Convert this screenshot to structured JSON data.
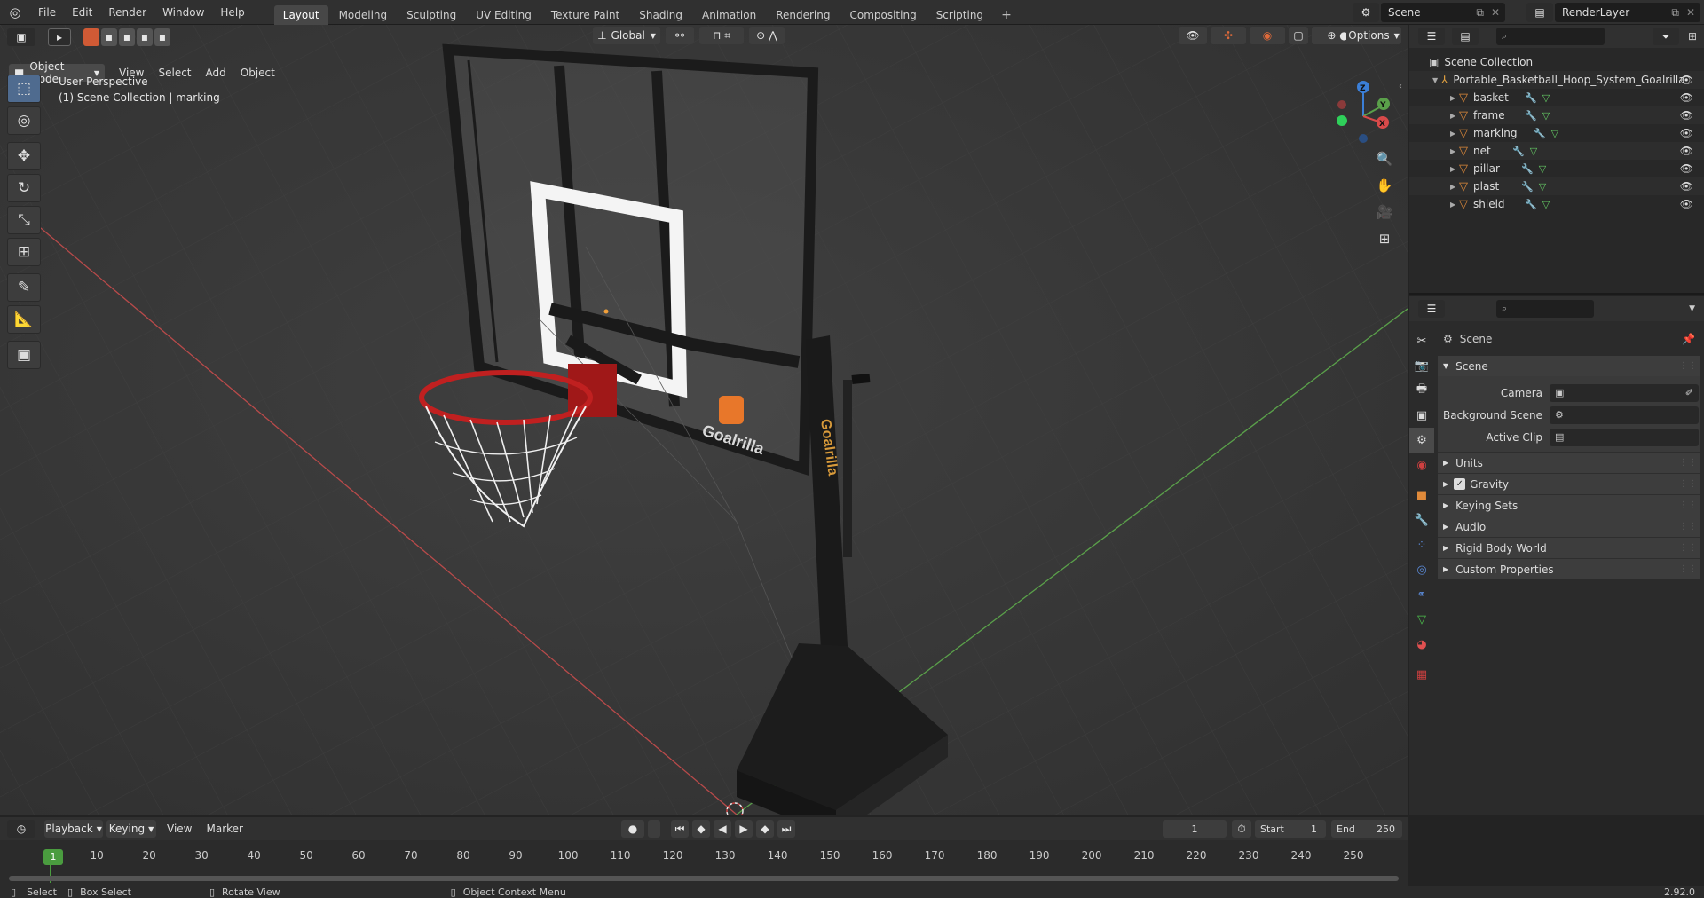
{
  "topbar": {
    "menus": [
      "File",
      "Edit",
      "Render",
      "Window",
      "Help"
    ],
    "tabs": [
      "Layout",
      "Modeling",
      "Sculpting",
      "UV Editing",
      "Texture Paint",
      "Shading",
      "Animation",
      "Rendering",
      "Compositing",
      "Scripting"
    ],
    "scene": "Scene",
    "render_layer": "RenderLayer"
  },
  "viewport": {
    "mode": "Object Mode",
    "menus": [
      "View",
      "Select",
      "Add",
      "Object"
    ],
    "transform": "Global",
    "options": "Options",
    "perspective": "User Perspective",
    "collection_info": "(1) Scene Collection | marking",
    "axes": [
      "X",
      "Y",
      "Z"
    ],
    "brand_text": "Goalrilla"
  },
  "outliner": {
    "root": "Scene Collection",
    "object": "Portable_Basketball_Hoop_System_Goalrilla",
    "children": [
      "basket",
      "frame",
      "marking",
      "net",
      "pillar",
      "plast",
      "shield"
    ]
  },
  "properties": {
    "header": "Scene",
    "panel": "Scene",
    "fields": [
      {
        "label": "Camera",
        "value": ""
      },
      {
        "label": "Background Scene",
        "value": ""
      },
      {
        "label": "Active Clip",
        "value": ""
      }
    ],
    "sections": [
      "Units",
      "Gravity",
      "Keying Sets",
      "Audio",
      "Rigid Body World",
      "Custom Properties"
    ]
  },
  "timeline": {
    "menus": [
      "Playback",
      "Keying",
      "View",
      "Marker"
    ],
    "current_frame": "1",
    "start_label": "Start",
    "start": "1",
    "end_label": "End",
    "end": "250",
    "ruler": [
      "1",
      "10",
      "20",
      "30",
      "40",
      "50",
      "60",
      "70",
      "80",
      "90",
      "100",
      "110",
      "120",
      "130",
      "140",
      "150",
      "160",
      "170",
      "180",
      "190",
      "200",
      "210",
      "220",
      "230",
      "240",
      "250"
    ]
  },
  "statusbar": {
    "items": [
      "Select",
      "Box Select",
      "Rotate View",
      "Object Context Menu"
    ],
    "version": "2.92.0"
  },
  "colors": {
    "accent": "#4772b3",
    "frame_green": "#4a9c3f",
    "mesh_orange": "#e08a3a"
  }
}
